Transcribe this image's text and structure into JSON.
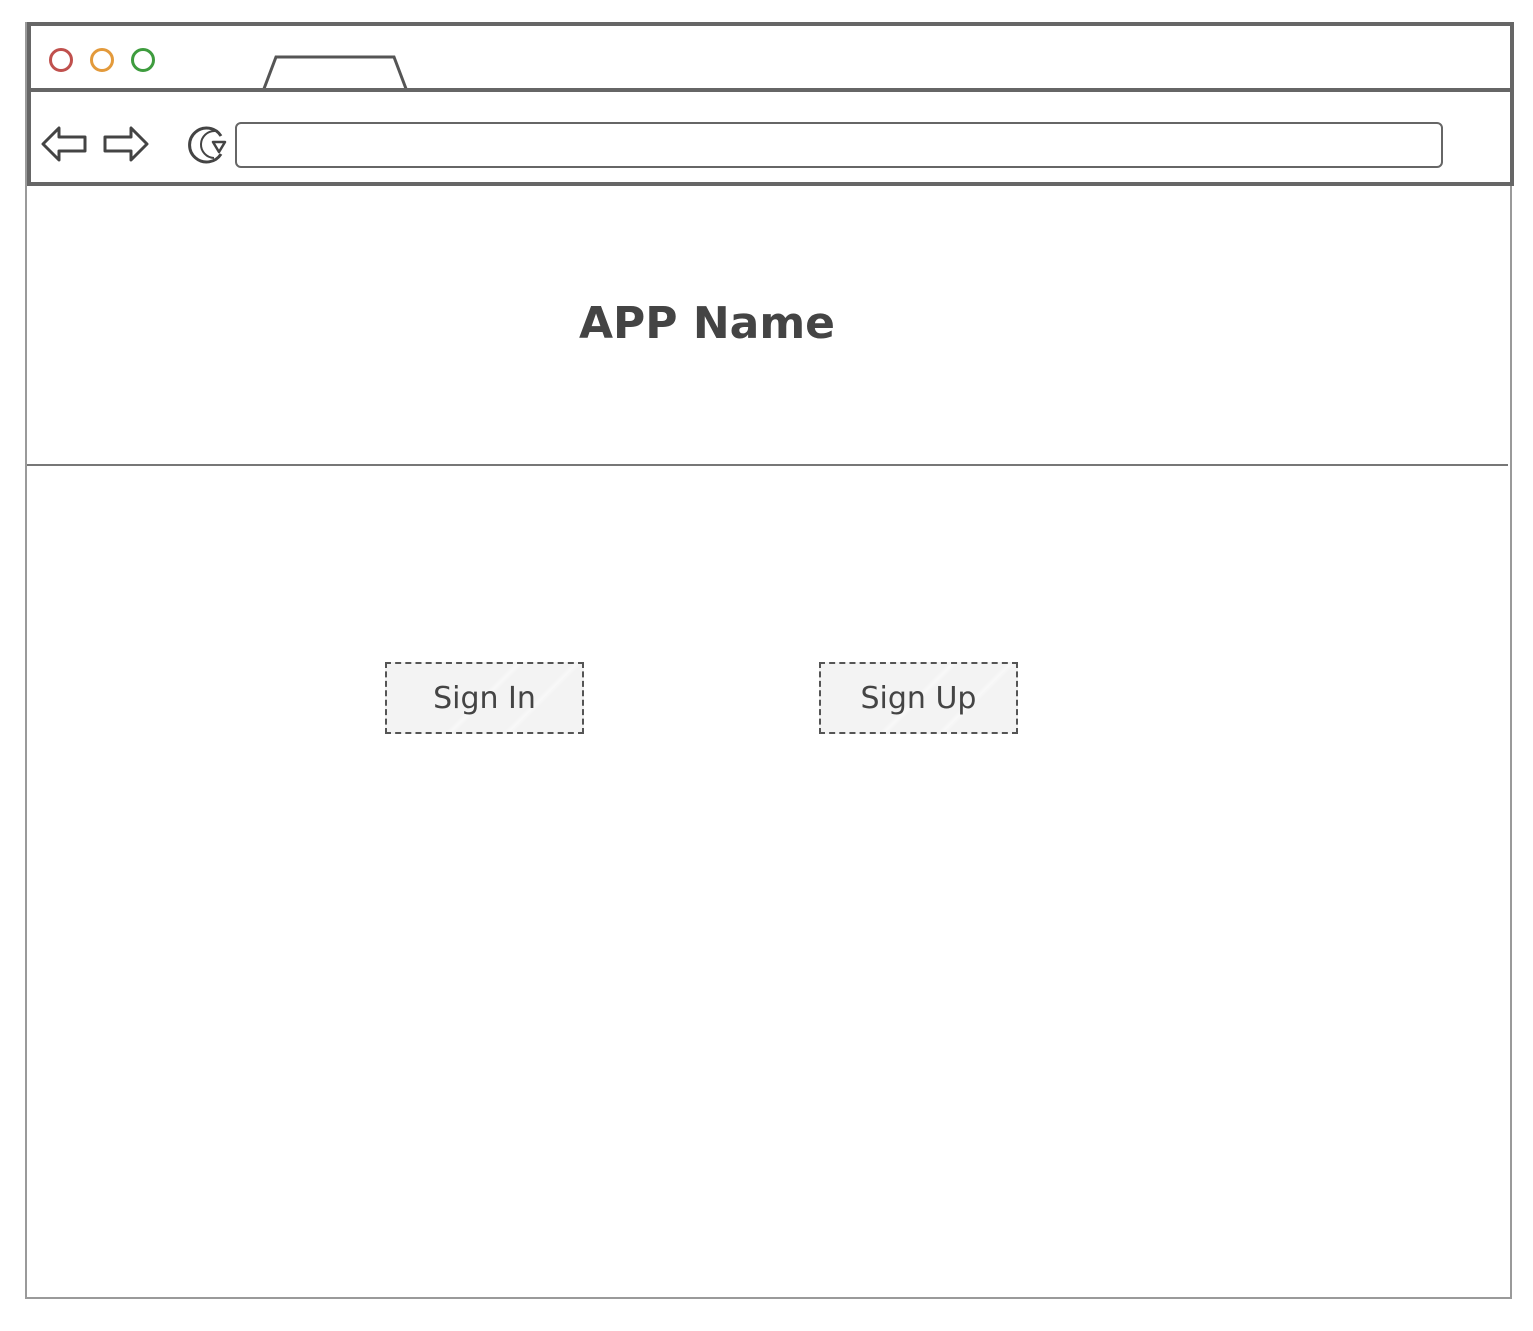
{
  "window": {
    "traffic_lights": {
      "close_color": "#c0504d",
      "minimize_color": "#e39a3b",
      "maximize_color": "#3e9c3e"
    },
    "tab_label": "",
    "nav": {
      "back_icon": "back-arrow-icon",
      "forward_icon": "forward-arrow-icon",
      "reload_icon": "reload-icon"
    },
    "address_bar": {
      "value": "",
      "placeholder": ""
    }
  },
  "main": {
    "app_title": "APP Name",
    "signin_label": "Sign In",
    "signup_label": "Sign Up"
  }
}
